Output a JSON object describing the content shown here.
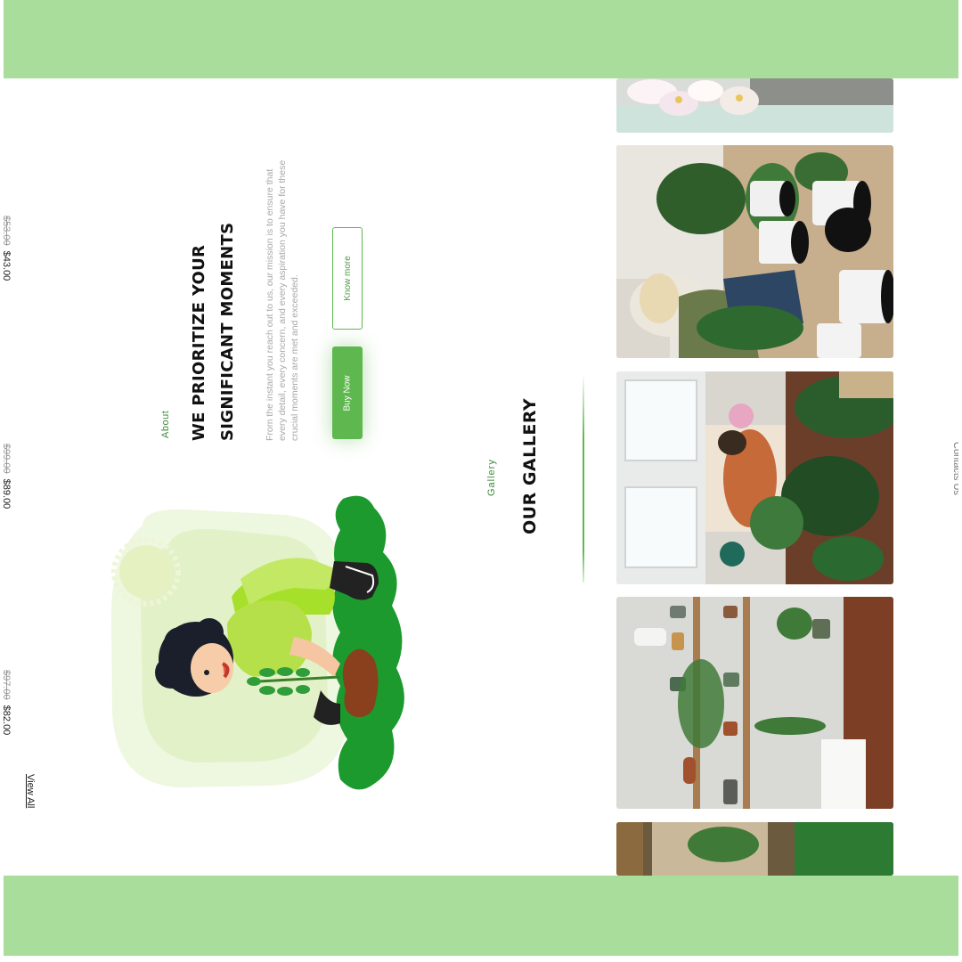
{
  "prices": [
    {
      "old": "$53.00",
      "new": "$43.00"
    },
    {
      "old": "$99.00",
      "new": "$89.00"
    },
    {
      "old": "$97.00",
      "new": "$82.00"
    }
  ],
  "shop": {
    "view_all": "View All"
  },
  "about": {
    "label": "About",
    "headline_line1": "WE PRIORITIZE YOUR",
    "headline_line2": "SIGNIFICANT MOMENTS",
    "paragraph": "From the instant you reach out to us, our mission is to ensure that every detail, every concern, and every aspiration you have for these crucial moments are met and exceeded.",
    "buy_label": "Buy Now",
    "know_label": "Know more"
  },
  "gallery": {
    "label": "Gallery",
    "title": "OUR GALLERY"
  },
  "contacts": {
    "label": "Contacts Us"
  },
  "colors": {
    "accent": "#5fb84f",
    "band": "#a8dd9b",
    "heading": "#111111"
  },
  "icons": [
    "plant-boy-illustration",
    "sun-illustration"
  ]
}
